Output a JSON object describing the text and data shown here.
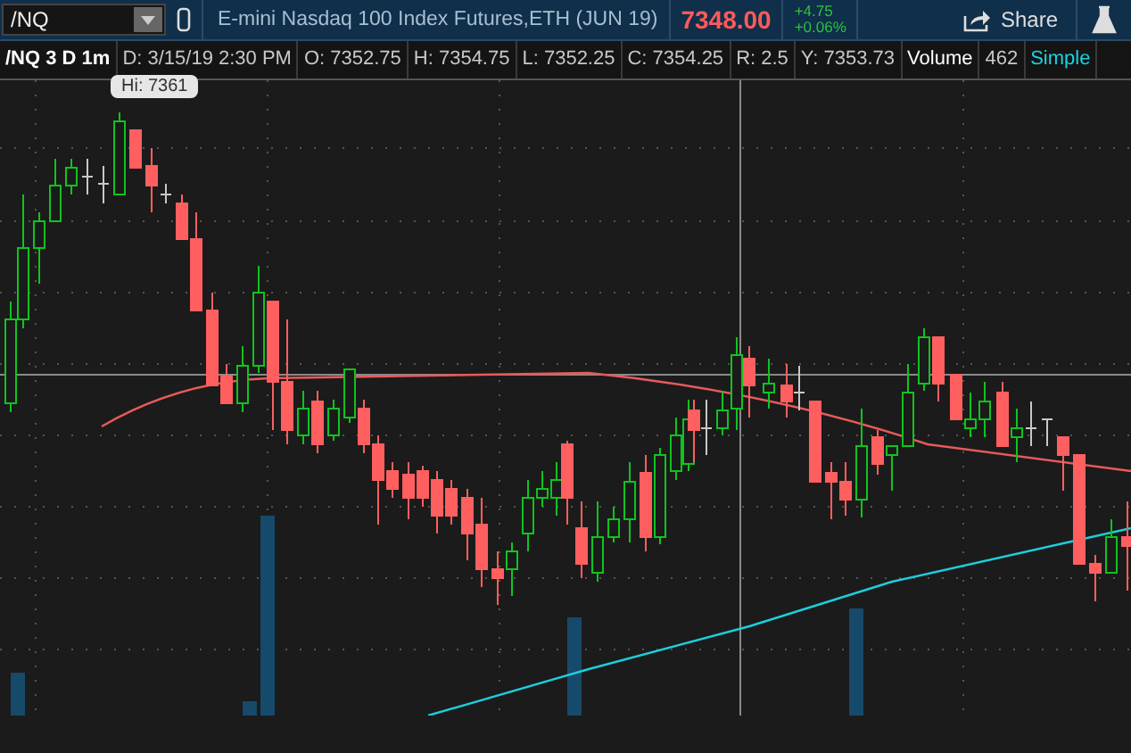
{
  "symbol_field": {
    "value": "/NQ"
  },
  "instrument": {
    "description": "E-mini Nasdaq 100 Index Futures,ETH (JUN 19)",
    "last_price": "7348.00",
    "change": "+4.75",
    "change_percent": "+0.06%"
  },
  "share_button": {
    "label": "Share"
  },
  "info_bar": {
    "chart_label": "/NQ 3 D 1m",
    "fields": [
      "D: 3/15/19 2:30 PM",
      "O: 7352.75",
      "H: 7354.75",
      "L: 7352.25",
      "C: 7354.25",
      "R: 2.5",
      "Y: 7353.73"
    ],
    "volume_label": "Volume",
    "volume_value": "462",
    "study": "Simple"
  },
  "chart": {
    "high_marker": "Hi: 7361"
  }
}
